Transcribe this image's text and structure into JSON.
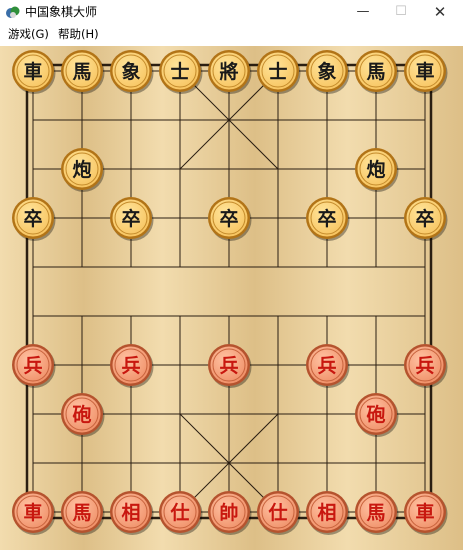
{
  "window": {
    "title": "中国象棋大师",
    "icon": "chess-app-icon",
    "minimize_glyph": "—",
    "maximize_glyph": "☐",
    "close_glyph": "✕"
  },
  "menu": [
    {
      "label": "游戏(G)"
    },
    {
      "label": "帮助(H)"
    }
  ],
  "colors": {
    "board_light": "#f2dcae",
    "board_dark": "#ddbf87",
    "line": "#2a1e12",
    "piece_black_face": "#f7c35e",
    "piece_black_text": "#1a1a1a",
    "piece_red_face": "#ef8e66",
    "piece_red_text": "#c8170f"
  },
  "board": {
    "files": 9,
    "ranks": 10,
    "river_text": "",
    "pieces": [
      {
        "side": "black",
        "char": "車",
        "file": 0,
        "rank": 0
      },
      {
        "side": "black",
        "char": "馬",
        "file": 1,
        "rank": 0
      },
      {
        "side": "black",
        "char": "象",
        "file": 2,
        "rank": 0
      },
      {
        "side": "black",
        "char": "士",
        "file": 3,
        "rank": 0
      },
      {
        "side": "black",
        "char": "將",
        "file": 4,
        "rank": 0
      },
      {
        "side": "black",
        "char": "士",
        "file": 5,
        "rank": 0
      },
      {
        "side": "black",
        "char": "象",
        "file": 6,
        "rank": 0
      },
      {
        "side": "black",
        "char": "馬",
        "file": 7,
        "rank": 0
      },
      {
        "side": "black",
        "char": "車",
        "file": 8,
        "rank": 0
      },
      {
        "side": "black",
        "char": "炮",
        "file": 1,
        "rank": 2
      },
      {
        "side": "black",
        "char": "炮",
        "file": 7,
        "rank": 2
      },
      {
        "side": "black",
        "char": "卒",
        "file": 0,
        "rank": 3
      },
      {
        "side": "black",
        "char": "卒",
        "file": 2,
        "rank": 3
      },
      {
        "side": "black",
        "char": "卒",
        "file": 4,
        "rank": 3
      },
      {
        "side": "black",
        "char": "卒",
        "file": 6,
        "rank": 3
      },
      {
        "side": "black",
        "char": "卒",
        "file": 8,
        "rank": 3
      },
      {
        "side": "red",
        "char": "兵",
        "file": 0,
        "rank": 6
      },
      {
        "side": "red",
        "char": "兵",
        "file": 2,
        "rank": 6
      },
      {
        "side": "red",
        "char": "兵",
        "file": 4,
        "rank": 6
      },
      {
        "side": "red",
        "char": "兵",
        "file": 6,
        "rank": 6
      },
      {
        "side": "red",
        "char": "兵",
        "file": 8,
        "rank": 6
      },
      {
        "side": "red",
        "char": "砲",
        "file": 1,
        "rank": 7
      },
      {
        "side": "red",
        "char": "砲",
        "file": 7,
        "rank": 7
      },
      {
        "side": "red",
        "char": "車",
        "file": 0,
        "rank": 9
      },
      {
        "side": "red",
        "char": "馬",
        "file": 1,
        "rank": 9
      },
      {
        "side": "red",
        "char": "相",
        "file": 2,
        "rank": 9
      },
      {
        "side": "red",
        "char": "仕",
        "file": 3,
        "rank": 9
      },
      {
        "side": "red",
        "char": "帥",
        "file": 4,
        "rank": 9
      },
      {
        "side": "red",
        "char": "仕",
        "file": 5,
        "rank": 9
      },
      {
        "side": "red",
        "char": "相",
        "file": 6,
        "rank": 9
      },
      {
        "side": "red",
        "char": "馬",
        "file": 7,
        "rank": 9
      },
      {
        "side": "red",
        "char": "車",
        "file": 8,
        "rank": 9
      }
    ]
  }
}
